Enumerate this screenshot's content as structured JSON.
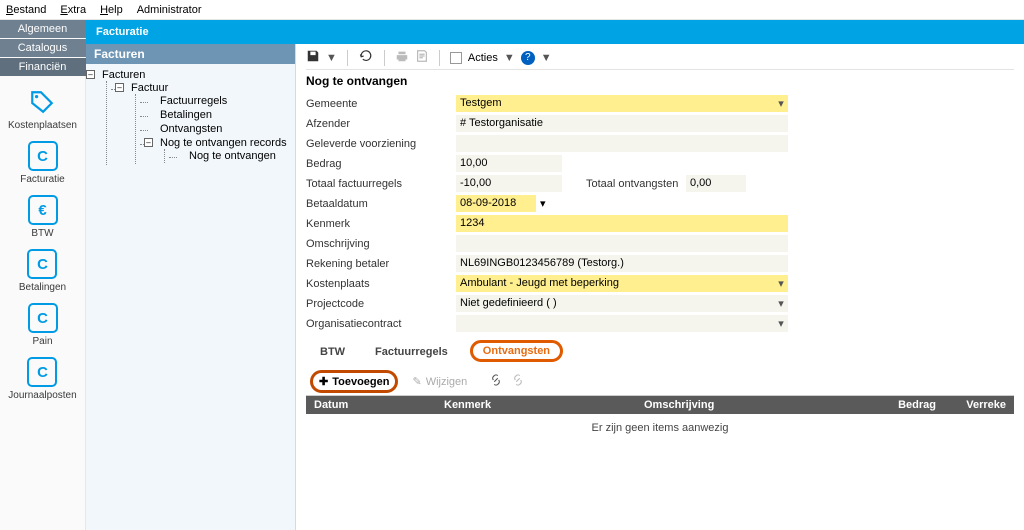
{
  "menubar": [
    "Bestand",
    "Extra",
    "Help",
    "Administrator"
  ],
  "sidebar_tabs": [
    "Algemeen",
    "Catalogus",
    "Financiën"
  ],
  "title": "Facturatie",
  "sidebar_items": [
    {
      "label": "Kostenplaatsen",
      "icon": "tag"
    },
    {
      "label": "Facturatie",
      "icon": "C"
    },
    {
      "label": "BTW",
      "icon": "€"
    },
    {
      "label": "Betalingen",
      "icon": "C"
    },
    {
      "label": "Pain",
      "icon": "C"
    },
    {
      "label": "Journaalposten",
      "icon": "C"
    }
  ],
  "tree": {
    "header": "Facturen",
    "root": "Facturen",
    "factuur": "Factuur",
    "factuurregels": "Factuurregels",
    "betalingen": "Betalingen",
    "ontvangsten": "Ontvangsten",
    "nog_records": "Nog te ontvangen records",
    "nog_leaf": "Nog te ontvangen"
  },
  "toolbar": {
    "acties": "Acties"
  },
  "record": {
    "title": "Nog te ontvangen",
    "labels": {
      "gemeente": "Gemeente",
      "afzender": "Afzender",
      "voorziening": "Geleverde voorziening",
      "bedrag": "Bedrag",
      "totaal_f": "Totaal factuurregels",
      "totaal_o": "Totaal ontvangsten",
      "betaaldatum": "Betaaldatum",
      "kenmerk": "Kenmerk",
      "omschrijving": "Omschrijving",
      "rekening": "Rekening betaler",
      "kostenplaats": "Kostenplaats",
      "projectcode": "Projectcode",
      "orgcontract": "Organisatiecontract"
    },
    "values": {
      "gemeente": "Testgem",
      "afzender": "# Testorganisatie",
      "bedrag": "10,00",
      "totaal_f": "-10,00",
      "totaal_o": "0,00",
      "betaaldatum": "08-09-2018",
      "kenmerk": "1234",
      "rekening": "NL69INGB0123456789 (Testorg.)",
      "kostenplaats": "Ambulant - Jeugd met beperking",
      "projectcode": "Niet gedefinieerd ( )"
    }
  },
  "subtabs": [
    "BTW",
    "Factuurregels",
    "Ontvangsten"
  ],
  "subtoolbar": {
    "toevoegen": "Toevoegen",
    "wijzigen": "Wijzigen"
  },
  "grid": {
    "headers": [
      "Datum",
      "Kenmerk",
      "Omschrijving",
      "Bedrag",
      "Verreke"
    ],
    "empty": "Er zijn geen items aanwezig"
  }
}
